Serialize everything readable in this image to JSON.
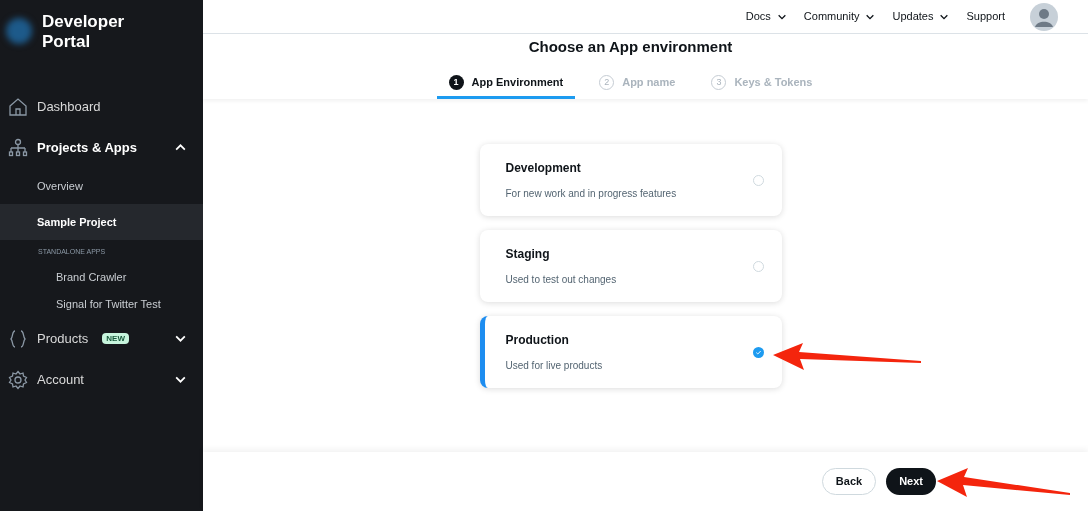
{
  "sidebar": {
    "logo": "Developer Portal",
    "items": [
      {
        "kind": "nav",
        "label": "Dashboard",
        "selected": false
      },
      {
        "kind": "nav",
        "label": "Projects & Apps",
        "selected": false,
        "expanded": true
      },
      {
        "kind": "sub",
        "label": "Overview",
        "selected": false
      },
      {
        "kind": "sub",
        "label": "Sample Project",
        "selected": true
      },
      {
        "kind": "section",
        "label": "STANDALONE APPS"
      },
      {
        "kind": "app",
        "label": "Brand Crawler",
        "selected": false
      },
      {
        "kind": "app",
        "label": "Signal for Twitter Test",
        "selected": false
      },
      {
        "kind": "nav",
        "label": "Products",
        "badge": "NEW",
        "selected": false,
        "expanded": false
      },
      {
        "kind": "nav",
        "label": "Account",
        "selected": false,
        "expanded": false
      }
    ]
  },
  "topnav": [
    {
      "label": "Docs",
      "dropdown": true
    },
    {
      "label": "Community",
      "dropdown": true
    },
    {
      "label": "Updates",
      "dropdown": true
    },
    {
      "label": "Support",
      "dropdown": false
    }
  ],
  "heading": "Choose an App environment",
  "steps": [
    {
      "number": "1",
      "label": "App Environment",
      "selected": true
    },
    {
      "number": "2",
      "label": "App name",
      "selected": false
    },
    {
      "number": "3",
      "label": "Keys & Tokens",
      "selected": false
    }
  ],
  "options": [
    {
      "title": "Development",
      "description": "For new work and in progress features",
      "selected": false
    },
    {
      "title": "Staging",
      "description": "Used to test out changes",
      "selected": false
    },
    {
      "title": "Production",
      "description": "Used for live products",
      "selected": true
    }
  ],
  "buttons": [
    {
      "kind": "secondary",
      "label": "Back"
    },
    {
      "kind": "primary",
      "label": "Next"
    }
  ]
}
